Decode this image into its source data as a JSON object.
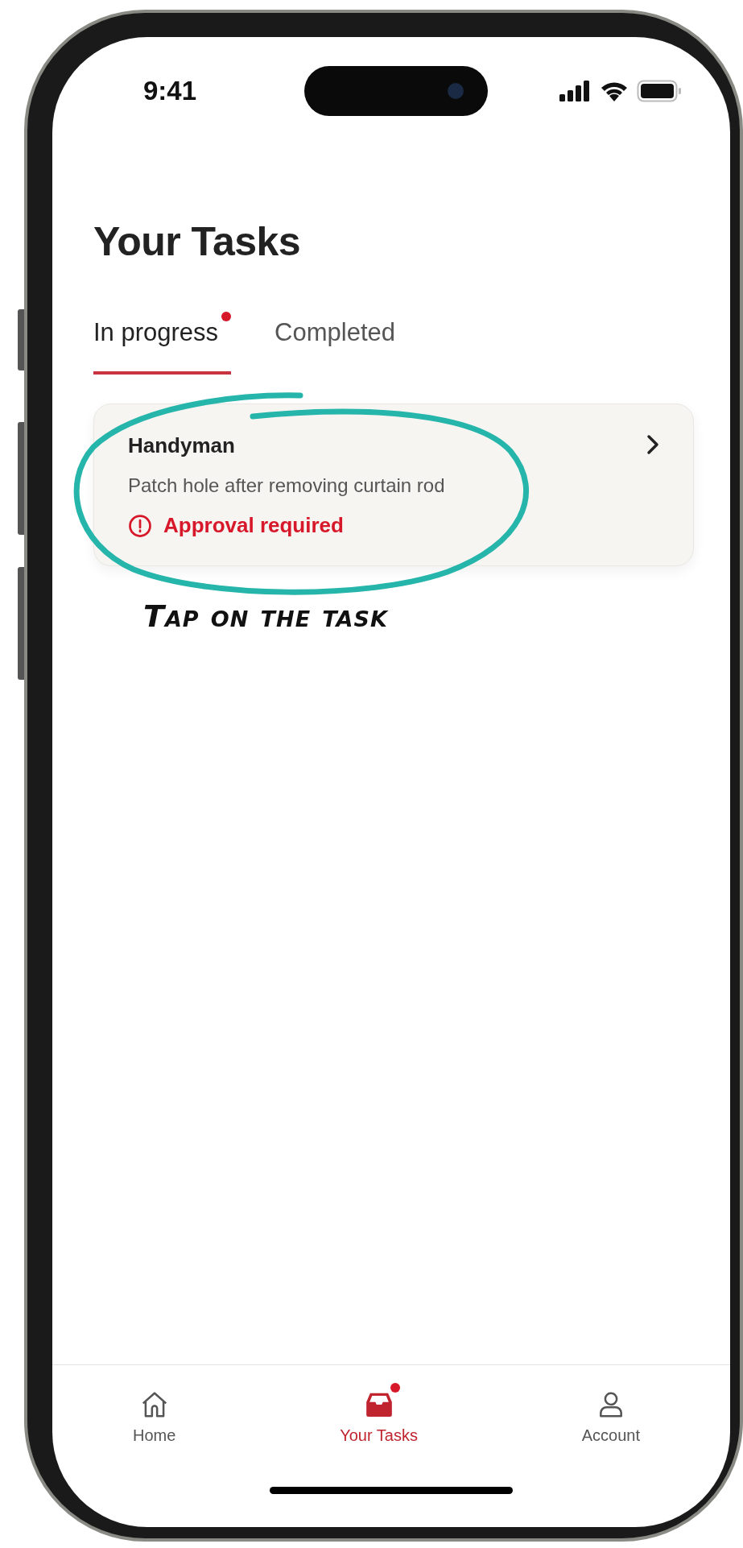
{
  "status_bar": {
    "time": "9:41"
  },
  "title": "Your Tasks",
  "tabs": [
    {
      "label": "In progress",
      "selected": true,
      "badge": true
    },
    {
      "label": "Completed",
      "selected": false,
      "badge": false
    }
  ],
  "tasks": [
    {
      "title": "Handyman",
      "description": "Patch hole after removing curtain rod",
      "status": "Approval required",
      "alert": true
    }
  ],
  "annotation": {
    "text": "Tap on the task"
  },
  "bottom_nav": [
    {
      "kind": "home",
      "label": "Home",
      "selected": false,
      "badge": false
    },
    {
      "kind": "tasks",
      "label": "Your Tasks",
      "selected": true,
      "badge": true
    },
    {
      "kind": "account",
      "label": "Account",
      "selected": false,
      "badge": false
    }
  ]
}
